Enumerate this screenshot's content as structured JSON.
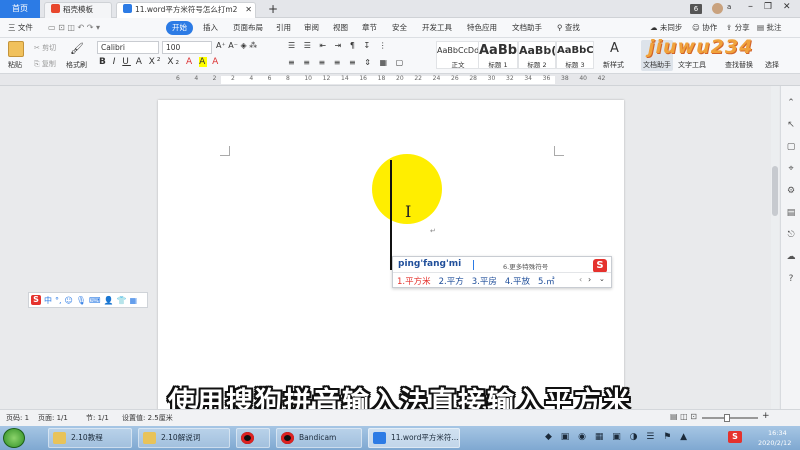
{
  "titlebar": {
    "home_tab": "首页",
    "tabs": [
      {
        "label": "稻壳模板"
      },
      {
        "label": "11.word平方米符号怎么打m2"
      }
    ],
    "add_tab": "+",
    "badge": "6",
    "user": "a"
  },
  "menubar": {
    "file": "三 文件",
    "items": [
      "开始",
      "插入",
      "页面布局",
      "引用",
      "审阅",
      "视图",
      "章节",
      "安全",
      "开发工具",
      "特色应用",
      "文档助手"
    ],
    "search": "查找",
    "sync": "未同步",
    "collab": "协作",
    "share": "分享",
    "annotate": "批注"
  },
  "ribbon": {
    "paste": "粘贴",
    "cut": "剪切",
    "copy": "复制",
    "format_painter": "格式刷",
    "font": "Calibri",
    "font_size": "100",
    "styles": [
      {
        "preview": "AaBbCcDd",
        "name": "正文"
      },
      {
        "preview": "AaBb",
        "name": "标题 1"
      },
      {
        "preview": "AaBb(",
        "name": "标题 2"
      },
      {
        "preview": "AaBbC",
        "name": "标题 3"
      }
    ],
    "new_style": "新样式",
    "doc_assistant": "文档助手",
    "text_tools": "文字工具",
    "find_replace": "查找替换",
    "select": "选择"
  },
  "ruler": {
    "ticks": [
      "6",
      "4",
      "2",
      "2",
      "4",
      "6",
      "8",
      "10",
      "12",
      "14",
      "16",
      "18",
      "20",
      "22",
      "24",
      "26",
      "28",
      "30",
      "32",
      "34",
      "36",
      "38",
      "40",
      "42"
    ]
  },
  "ime": {
    "input": "ping'fang'mi",
    "more": "6.更多特殊符号",
    "candidates": [
      "1.平方米",
      "2.平方",
      "3.平房",
      "4.平放",
      "5.㎡"
    ]
  },
  "imebar": {
    "label": "中"
  },
  "subtitle": "使用搜狗拼音输入法直接输入平方米",
  "status": {
    "page_num": "页码: 1",
    "pages": "页面: 1/1",
    "section": "节: 1/1",
    "setting": "设置值: 2.5厘米"
  },
  "taskbar": {
    "apps": [
      {
        "label": "2.10教程"
      },
      {
        "label": "2.10解说词"
      },
      {
        "label": ""
      },
      {
        "label": "Bandicam"
      },
      {
        "label": "11.word平方米符..."
      }
    ],
    "time": "16:34",
    "date": "2020/2/12"
  },
  "watermark": "jiuwu234",
  "colors": {
    "accent": "#2c7be5",
    "highlight": "#ffee00",
    "ime_red": "#e5322d",
    "taskbar": "#8db3da"
  }
}
